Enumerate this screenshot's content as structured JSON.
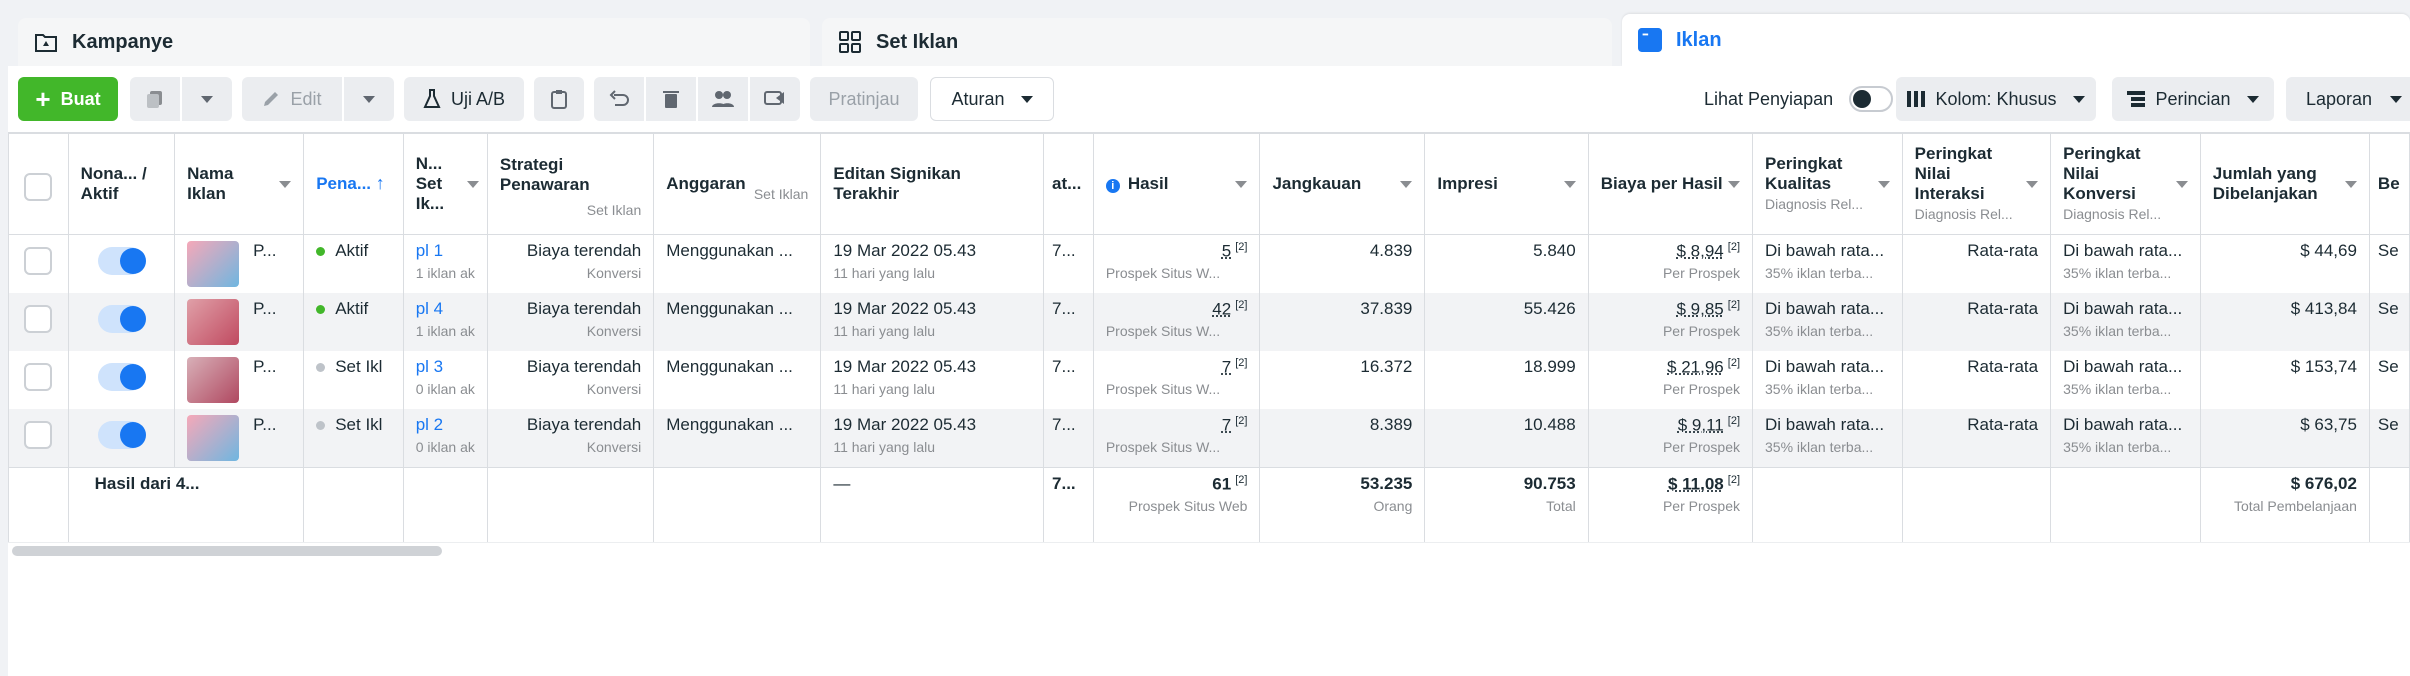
{
  "tabs": {
    "campaign": "Kampanye",
    "adset": "Set Iklan",
    "ads": "Iklan"
  },
  "toolbar": {
    "create": "Buat",
    "edit": "Edit",
    "ab_test": "Uji A/B",
    "preview": "Pratinjau",
    "rules": "Aturan",
    "view_setup": "Lihat Penyiapan",
    "columns": "Kolom: Khusus",
    "breakdown": "Perincian",
    "reports": "Laporan"
  },
  "headers": {
    "on_off": "Nona... / Aktif",
    "ad_name": "Nama Iklan",
    "delivery": "Pena...",
    "adset_name": "N... Set Ik...",
    "bid_strategy": "Strategi Penawaran",
    "bid_strategy_sub": "Set Iklan",
    "budget": "Anggaran",
    "budget_sub": "Set Iklan",
    "last_edit": "Editan Signikan Terakhir",
    "attribution": "at...",
    "results": "Hasil",
    "reach": "Jangkauan",
    "impressions": "Impresi",
    "cost_per_result": "Biaya per Hasil",
    "quality_ranking": "Peringkat Kualitas",
    "quality_ranking_sub": "Diagnosis Rel...",
    "engagement_ranking": "Peringkat Nilai Interaksi",
    "engagement_ranking_sub": "Diagnosis Rel...",
    "conversion_ranking": "Peringkat Nilai Konversi",
    "conversion_ranking_sub": "Diagnosis Rel...",
    "amount_spent": "Jumlah yang Dibelanjakan",
    "next": "Be"
  },
  "rows": [
    {
      "name": "P...",
      "delivery": "Aktif",
      "delivery_color": "#42b72a",
      "adset": "pl 1",
      "adset_sub": "1 iklan ak",
      "bid": "Biaya terendah",
      "bid_sub": "Konversi",
      "budget": "Menggunakan ...",
      "edit_date": "19 Mar 2022 05.43",
      "edit_ago": "11 hari yang lalu",
      "attr": "7...",
      "result": "5",
      "result_sub": "Prospek Situs W...",
      "reach": "4.839",
      "impressions": "5.840",
      "cpr": "$ 8,94",
      "cpr_sub": "Per Prospek",
      "quality": "Di bawah rata...",
      "quality_sub": "35% iklan terba...",
      "engagement": "Rata-rata",
      "conversion": "Di bawah rata...",
      "conversion_sub": "35% iklan terba...",
      "spent": "$ 44,69",
      "next": "Se"
    },
    {
      "name": "P...",
      "delivery": "Aktif",
      "delivery_color": "#42b72a",
      "adset": "pl 4",
      "adset_sub": "1 iklan ak",
      "bid": "Biaya terendah",
      "bid_sub": "Konversi",
      "budget": "Menggunakan ...",
      "edit_date": "19 Mar 2022 05.43",
      "edit_ago": "11 hari yang lalu",
      "attr": "7...",
      "result": "42",
      "result_sub": "Prospek Situs W...",
      "reach": "37.839",
      "impressions": "55.426",
      "cpr": "$ 9,85",
      "cpr_sub": "Per Prospek",
      "quality": "Di bawah rata...",
      "quality_sub": "35% iklan terba...",
      "engagement": "Rata-rata",
      "conversion": "Di bawah rata...",
      "conversion_sub": "35% iklan terba...",
      "spent": "$ 413,84",
      "next": "Se"
    },
    {
      "name": "P...",
      "delivery": "Set Ikl",
      "delivery_color": "#bec3c9",
      "adset": "pl 3",
      "adset_sub": "0 iklan ak",
      "bid": "Biaya terendah",
      "bid_sub": "Konversi",
      "budget": "Menggunakan ...",
      "edit_date": "19 Mar 2022 05.43",
      "edit_ago": "11 hari yang lalu",
      "attr": "7...",
      "result": "7",
      "result_sub": "Prospek Situs W...",
      "reach": "16.372",
      "impressions": "18.999",
      "cpr": "$ 21,96",
      "cpr_sub": "Per Prospek",
      "quality": "Di bawah rata...",
      "quality_sub": "35% iklan terba...",
      "engagement": "Rata-rata",
      "conversion": "Di bawah rata...",
      "conversion_sub": "35% iklan terba...",
      "spent": "$ 153,74",
      "next": "Se"
    },
    {
      "name": "P...",
      "delivery": "Set Ikl",
      "delivery_color": "#bec3c9",
      "adset": "pl 2",
      "adset_sub": "0 iklan ak",
      "bid": "Biaya terendah",
      "bid_sub": "Konversi",
      "budget": "Menggunakan ...",
      "edit_date": "19 Mar 2022 05.43",
      "edit_ago": "11 hari yang lalu",
      "attr": "7...",
      "result": "7",
      "result_sub": "Prospek Situs W...",
      "reach": "8.389",
      "impressions": "10.488",
      "cpr": "$ 9,11",
      "cpr_sub": "Per Prospek",
      "quality": "Di bawah rata...",
      "quality_sub": "35% iklan terba...",
      "engagement": "Rata-rata",
      "conversion": "Di bawah rata...",
      "conversion_sub": "35% iklan terba...",
      "spent": "$ 63,75",
      "next": "Se"
    }
  ],
  "totals": {
    "label": "Hasil dari 4...",
    "last_edit": "—",
    "attr": "7...",
    "result": "61",
    "result_sub": "Prospek Situs Web",
    "reach": "53.235",
    "reach_sub": "Orang",
    "impressions": "90.753",
    "impressions_sub": "Total",
    "cpr": "$ 11,08",
    "cpr_sub": "Per Prospek",
    "spent": "$ 676,02",
    "spent_sub": "Total Pembelanjaan"
  },
  "footnote_mark": "[2]"
}
